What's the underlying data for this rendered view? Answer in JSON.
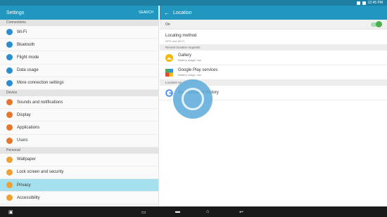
{
  "status": {
    "time": "12:45 PM"
  },
  "left": {
    "title": "Settings",
    "search": "SEARCH",
    "sections": [
      {
        "label": "Connections",
        "items": [
          {
            "label": "Wi-Fi",
            "color": "#2a8fd0",
            "icon": "wifi-icon"
          },
          {
            "label": "Bluetooth",
            "color": "#2a8fd0",
            "icon": "bluetooth-icon"
          },
          {
            "label": "Flight mode",
            "color": "#2a8fd0",
            "icon": "airplane-icon"
          },
          {
            "label": "Data usage",
            "color": "#2a8fd0",
            "icon": "data-usage-icon"
          },
          {
            "label": "More connection settings",
            "color": "#2a8fd0",
            "icon": "more-connections-icon"
          }
        ]
      },
      {
        "label": "Device",
        "items": [
          {
            "label": "Sounds and notifications",
            "color": "#e8762a",
            "icon": "sound-icon"
          },
          {
            "label": "Display",
            "color": "#e8762a",
            "icon": "display-icon"
          },
          {
            "label": "Applications",
            "color": "#e8762a",
            "icon": "apps-icon"
          },
          {
            "label": "Users",
            "color": "#e8762a",
            "icon": "users-icon"
          }
        ]
      },
      {
        "label": "Personal",
        "items": [
          {
            "label": "Wallpaper",
            "color": "#f0a030",
            "icon": "wallpaper-icon"
          },
          {
            "label": "Lock screen and security",
            "color": "#f0a030",
            "icon": "lock-icon"
          },
          {
            "label": "Privacy",
            "color": "#f0a030",
            "icon": "privacy-icon",
            "active": true
          },
          {
            "label": "Accessibility",
            "color": "#f0a030",
            "icon": "accessibility-icon"
          }
        ]
      }
    ]
  },
  "right": {
    "title": "Location",
    "on_label": "On",
    "locating_method": {
      "title": "Locating method",
      "sub": "GPS and Wi-Fi"
    },
    "recent_header": "Recent location requests",
    "recent": [
      {
        "title": "Gallery",
        "sub": "Battery usage: low"
      },
      {
        "title": "Google Play services",
        "sub": "Battery usage: low"
      }
    ],
    "services_header": "Location se",
    "history": {
      "title": "Go      e Location History"
    }
  }
}
